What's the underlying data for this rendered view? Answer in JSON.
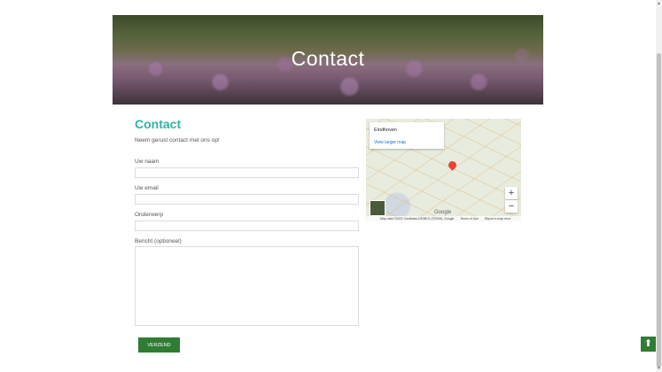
{
  "hero": {
    "title": "Contact"
  },
  "content": {
    "title": "Contact",
    "intro": "Neem gerust contact met ons op!"
  },
  "form": {
    "name_label": "Uw naam",
    "name_value": "",
    "email_label": "Uw email",
    "email_value": "",
    "subject_label": "Onderwerp",
    "subject_value": "",
    "message_label": "Bericht (optioneel)",
    "message_value": "",
    "submit_label": "VERZEND"
  },
  "map": {
    "place": "Eindhoven",
    "larger_map_link": "View larger map",
    "zoom_in": "+",
    "zoom_out": "−",
    "logo": "Google",
    "attribution": "Map data ©2021 GeoBasis-DE/BKG (©2009), Google",
    "terms": "Terms of Use",
    "report": "Report a map error"
  },
  "icons": {
    "back_to_top": "arrow-up-circle-icon",
    "map_pin": "map-pin-icon"
  },
  "colors": {
    "accent": "#2fb5a6",
    "button": "#2e7d32"
  }
}
